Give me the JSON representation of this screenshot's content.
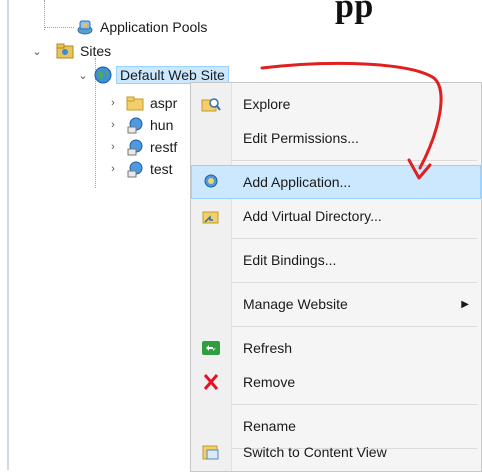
{
  "heading_fragment": "pp",
  "tree": {
    "application_pools": "Application Pools",
    "sites": "Sites",
    "default_web_site": "Default Web Site",
    "children": [
      "aspr",
      "hun",
      "restf",
      "test"
    ]
  },
  "context_menu": {
    "items": [
      {
        "label": "Explore",
        "icon": "explore-icon"
      },
      {
        "label": "Edit Permissions...",
        "icon": ""
      },
      {
        "label": "Add Application...",
        "icon": "add-application-icon"
      },
      {
        "label": "Add Virtual Directory...",
        "icon": "add-virtual-directory-icon"
      },
      {
        "label": "Edit Bindings...",
        "icon": ""
      },
      {
        "label": "Manage Website",
        "icon": ""
      },
      {
        "label": "Refresh",
        "icon": "refresh-icon"
      },
      {
        "label": "Remove",
        "icon": "remove-icon"
      },
      {
        "label": "Rename",
        "icon": ""
      },
      {
        "label": "Switch to Content View",
        "icon": "content-view-icon"
      }
    ],
    "highlighted": "Add Application..."
  },
  "colors": {
    "highlight_bg": "#cce8ff",
    "annotation_arrow": "#e02020",
    "remove_red": "#e81123",
    "refresh_green": "#2e9e3e"
  }
}
